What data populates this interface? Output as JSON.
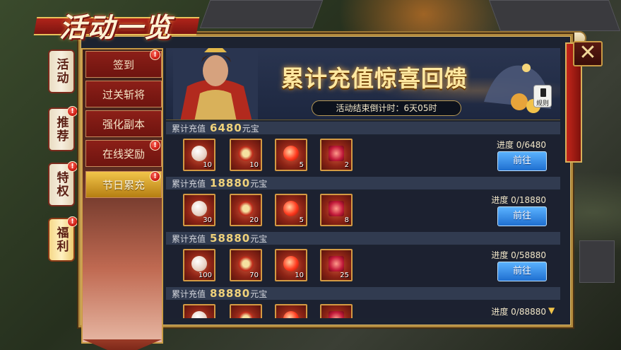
{
  "window": {
    "title": "活动一览"
  },
  "side_tabs": [
    {
      "label": "活动",
      "has_badge": false,
      "active": false
    },
    {
      "label": "推荐",
      "has_badge": true,
      "active": false
    },
    {
      "label": "特权",
      "has_badge": true,
      "active": false
    },
    {
      "label": "福利",
      "has_badge": true,
      "active": true
    }
  ],
  "menu": [
    {
      "label": "签到",
      "has_badge": true,
      "active": false
    },
    {
      "label": "过关斩将",
      "has_badge": false,
      "active": false
    },
    {
      "label": "强化副本",
      "has_badge": false,
      "active": false
    },
    {
      "label": "在线奖励",
      "has_badge": true,
      "active": false
    },
    {
      "label": "节日累充",
      "has_badge": true,
      "active": true
    }
  ],
  "badge_glyph": "!",
  "banner": {
    "title": "累计充值惊喜回馈",
    "countdown": "活动结束倒计时：6天05时",
    "rules_label": "规则"
  },
  "tiers": [
    {
      "prefix": "累计充值",
      "amount": "6480",
      "unit": "元宝",
      "items": [
        {
          "icon": "pearl-icon",
          "qty": "10"
        },
        {
          "icon": "feast-bowl-icon",
          "qty": "10"
        },
        {
          "icon": "red-orb-icon",
          "qty": "5"
        },
        {
          "icon": "red-crystal-icon",
          "qty": "2"
        }
      ],
      "progress": "进度  0/6480",
      "button": "前往"
    },
    {
      "prefix": "累计充值",
      "amount": "18880",
      "unit": "元宝",
      "items": [
        {
          "icon": "pearl-icon",
          "qty": "30"
        },
        {
          "icon": "feast-bowl-icon",
          "qty": "20"
        },
        {
          "icon": "red-orb-icon",
          "qty": "5"
        },
        {
          "icon": "red-crystal-icon",
          "qty": "8"
        }
      ],
      "progress": "进度  0/18880",
      "button": "前往"
    },
    {
      "prefix": "累计充值",
      "amount": "58880",
      "unit": "元宝",
      "items": [
        {
          "icon": "pearl-icon",
          "qty": "100"
        },
        {
          "icon": "feast-bowl-icon",
          "qty": "70"
        },
        {
          "icon": "red-orb-icon",
          "qty": "10"
        },
        {
          "icon": "red-crystal-icon",
          "qty": "25"
        }
      ],
      "progress": "进度  0/58880",
      "button": "前往"
    },
    {
      "prefix": "累计充值",
      "amount": "88880",
      "unit": "元宝",
      "items": [
        {
          "icon": "pearl-icon",
          "qty": ""
        },
        {
          "icon": "feast-bowl-icon",
          "qty": ""
        },
        {
          "icon": "red-orb-icon",
          "qty": ""
        },
        {
          "icon": "red-crystal-icon",
          "qty": ""
        }
      ],
      "progress": "进度  0/88880",
      "button": ""
    }
  ],
  "colors": {
    "accent_gold": "#f0d27a",
    "button_blue": "#1f6fd0",
    "menu_red": "#8c1f18",
    "badge_red": "#c8160f"
  }
}
